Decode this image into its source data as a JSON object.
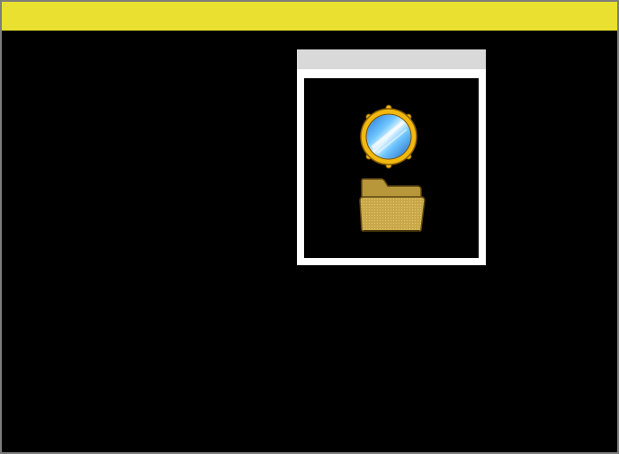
{
  "top_bar": {
    "title": "",
    "color": "#e9e02f"
  },
  "window": {
    "title": "",
    "icons": [
      {
        "name": "globe-icon"
      },
      {
        "name": "folder-icon"
      }
    ]
  }
}
